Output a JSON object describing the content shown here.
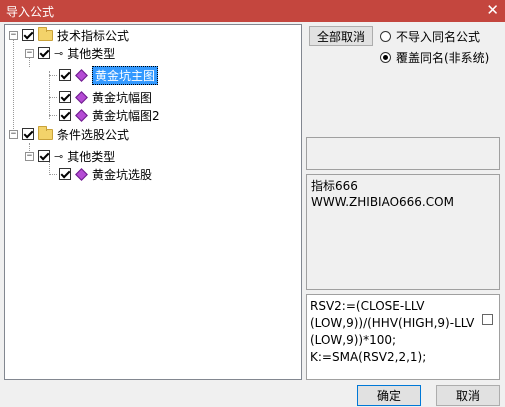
{
  "window": {
    "title": "导入公式",
    "close_glyph": "✕"
  },
  "tree": {
    "nodes": [
      {
        "label": "技术指标公式",
        "expanded": true,
        "checked": true
      },
      {
        "label": "其他类型",
        "expanded": true,
        "checked": true
      },
      {
        "label": "黄金坑主图",
        "checked": true,
        "selected": true
      },
      {
        "label": "黄金坑幅图",
        "checked": true
      },
      {
        "label": "黄金坑幅图2",
        "checked": true
      },
      {
        "label": "条件选股公式",
        "expanded": true,
        "checked": true
      },
      {
        "label": "其他类型",
        "expanded": true,
        "checked": true
      },
      {
        "label": "黄金坑选股",
        "checked": true
      }
    ],
    "expand_glyph": "−"
  },
  "options": {
    "cancel_all_label": "全部取消",
    "radio_no_import": "不导入同名公式",
    "radio_overwrite": "覆盖同名(非系统)",
    "selected": "radio_overwrite"
  },
  "description": {
    "line1": "指标666",
    "line2": "WWW.ZHIBIAO666.COM"
  },
  "formula": {
    "line1": "RSV2:=(CLOSE-LLV",
    "line2": "(LOW,9))/(HHV(HIGH,9)-LLV",
    "line3": "(LOW,9))*100;",
    "line4": "K:=SMA(RSV2,2,1);"
  },
  "buttons": {
    "ok": "确定",
    "cancel": "取消"
  }
}
